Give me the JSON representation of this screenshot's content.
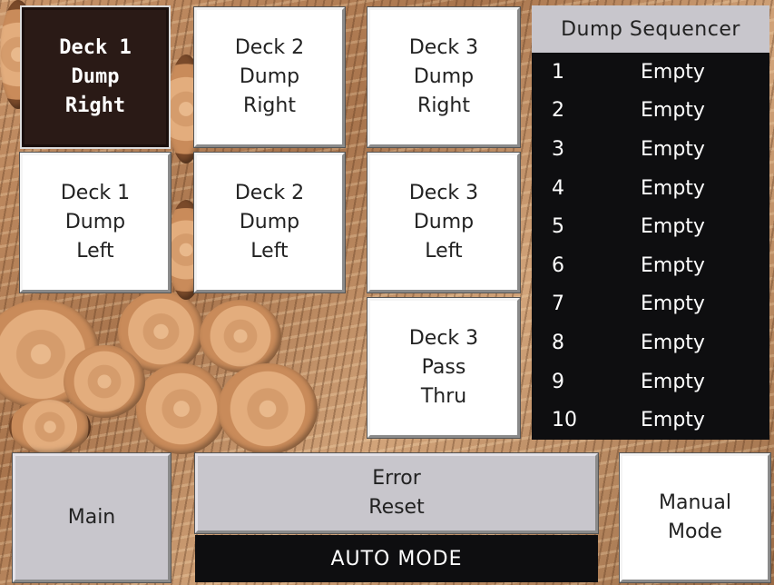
{
  "buttons": {
    "deck1_dump_right": "Deck 1\nDump\nRight",
    "deck2_dump_right": "Deck 2\nDump\nRight",
    "deck3_dump_right": "Deck 3\nDump\nRight",
    "deck1_dump_left": "Deck 1\nDump\nLeft",
    "deck2_dump_left": "Deck 2\nDump\nLeft",
    "deck3_dump_left": "Deck 3\nDump\nLeft",
    "deck3_pass_thru": "Deck 3\nPass\nThru",
    "main": "Main",
    "error_reset": "Error\nReset",
    "manual_mode": "Manual\nMode"
  },
  "sequencer": {
    "title": "Dump Sequencer",
    "rows": [
      {
        "num": "1",
        "value": "Empty"
      },
      {
        "num": "2",
        "value": "Empty"
      },
      {
        "num": "3",
        "value": "Empty"
      },
      {
        "num": "4",
        "value": "Empty"
      },
      {
        "num": "5",
        "value": "Empty"
      },
      {
        "num": "6",
        "value": "Empty"
      },
      {
        "num": "7",
        "value": "Empty"
      },
      {
        "num": "8",
        "value": "Empty"
      },
      {
        "num": "9",
        "value": "Empty"
      },
      {
        "num": "10",
        "value": "Empty"
      }
    ]
  },
  "status": {
    "mode": "AUTO MODE"
  },
  "colors": {
    "active_button": "#2a1a16",
    "panel_dark": "#0e0e10",
    "panel_gray": "#c8c6cc"
  }
}
